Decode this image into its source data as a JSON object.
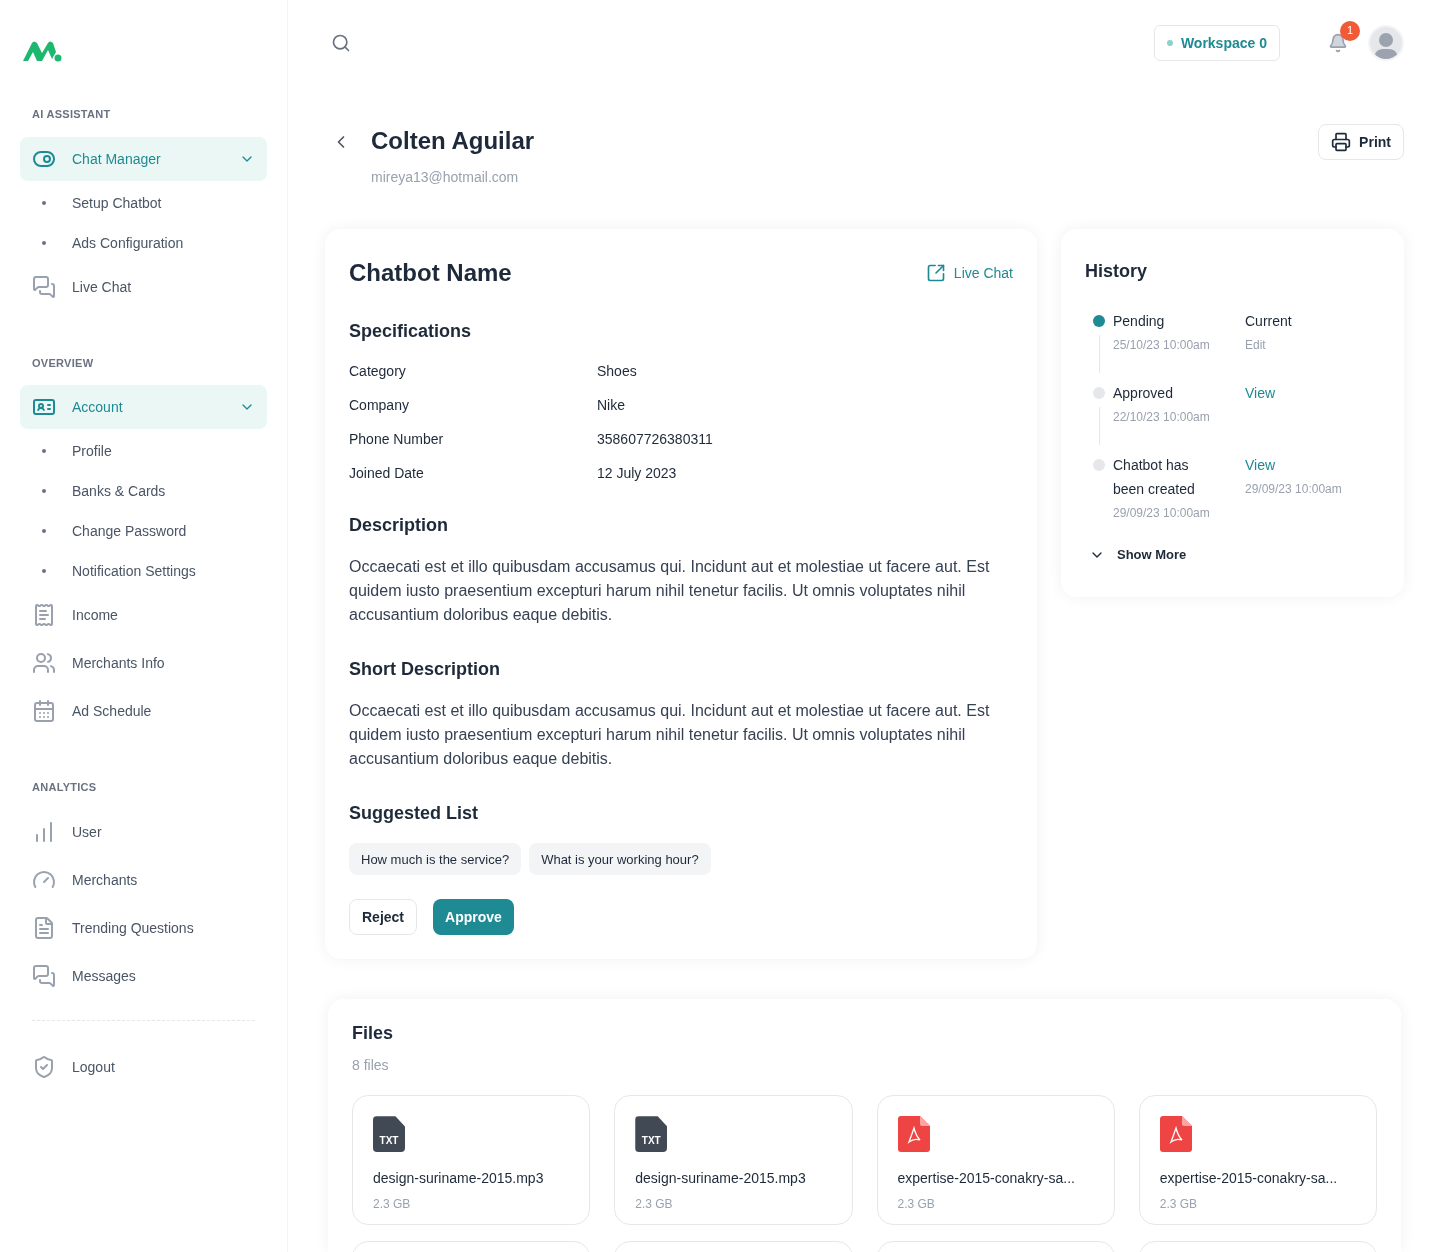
{
  "sidebar": {
    "sections": [
      {
        "title": "AI ASSISTANT",
        "items": [
          {
            "label": "Chat Manager",
            "expanded": true,
            "children": [
              {
                "label": "Setup Chatbot"
              },
              {
                "label": "Ads Configuration"
              }
            ]
          },
          {
            "label": "Live Chat"
          }
        ]
      },
      {
        "title": "OVERVIEW",
        "items": [
          {
            "label": "Account",
            "expanded": true,
            "children": [
              {
                "label": "Profile"
              },
              {
                "label": "Banks & Cards"
              },
              {
                "label": "Change Password"
              },
              {
                "label": "Notification Settings"
              }
            ]
          },
          {
            "label": "Income"
          },
          {
            "label": "Merchants Info"
          },
          {
            "label": "Ad Schedule"
          }
        ]
      },
      {
        "title": "ANALYTICS",
        "items": [
          {
            "label": "User"
          },
          {
            "label": "Merchants"
          },
          {
            "label": "Trending Questions"
          },
          {
            "label": "Messages"
          }
        ]
      }
    ],
    "logout": {
      "label": "Logout"
    }
  },
  "topbar": {
    "workspace": "Workspace 0",
    "notifications": "1"
  },
  "header": {
    "name": "Colten Aguilar",
    "email": "mireya13@hotmail.com",
    "print": "Print"
  },
  "chatbot": {
    "title": "Chatbot Name",
    "live_chat": "Live Chat",
    "specifications": {
      "title": "Specifications",
      "rows": [
        {
          "label": "Category",
          "value": "Shoes"
        },
        {
          "label": "Company",
          "value": "Nike"
        },
        {
          "label": "Phone Number",
          "value": "358607726380311"
        },
        {
          "label": "Joined Date",
          "value": "12 July 2023"
        }
      ]
    },
    "description": {
      "title": "Description",
      "text": "Occaecati est et illo quibusdam accusamus qui. Incidunt aut et molestiae ut facere aut. Est quidem iusto praesentium excepturi harum nihil tenetur facilis. Ut omnis voluptates nihil accusantium doloribus eaque debitis."
    },
    "short_description": {
      "title": "Short Description",
      "text": "Occaecati est et illo quibusdam accusamus qui. Incidunt aut et molestiae ut facere aut. Est quidem iusto praesentium excepturi harum nihil tenetur facilis. Ut omnis voluptates nihil accusantium doloribus eaque debitis."
    },
    "suggested": {
      "title": "Suggested List",
      "items": [
        "How much is the service?",
        "What is your working hour?"
      ]
    },
    "buttons": {
      "reject": "Reject",
      "approve": "Approve"
    }
  },
  "history": {
    "title": "History",
    "items": [
      {
        "status": "Pending",
        "date": "25/10/23 10:00am",
        "active": true,
        "action": {
          "kind": "status",
          "text": "Current",
          "note": "Edit"
        }
      },
      {
        "status": "Approved",
        "date": "22/10/23 10:00am",
        "active": false,
        "action": {
          "kind": "link",
          "text": "View"
        }
      },
      {
        "status": "Chatbot has been created",
        "date": "29/09/23 10:00am",
        "active": false,
        "action": {
          "kind": "link",
          "text": "View",
          "note": "29/09/23 10:00am"
        }
      }
    ],
    "show_more": "Show More"
  },
  "files": {
    "title": "Files",
    "count": "8 files",
    "items": [
      {
        "kind": "txt",
        "badge": "TXT",
        "name": "design-suriname-2015.mp3",
        "size": "2.3 GB"
      },
      {
        "kind": "txt",
        "badge": "TXT",
        "name": "design-suriname-2015.mp3",
        "size": "2.3 GB"
      },
      {
        "kind": "pdf",
        "name": "expertise-2015-conakry-sa...",
        "size": "2.3 GB"
      },
      {
        "kind": "pdf",
        "name": "expertise-2015-conakry-sa...",
        "size": "2.3 GB"
      }
    ]
  }
}
